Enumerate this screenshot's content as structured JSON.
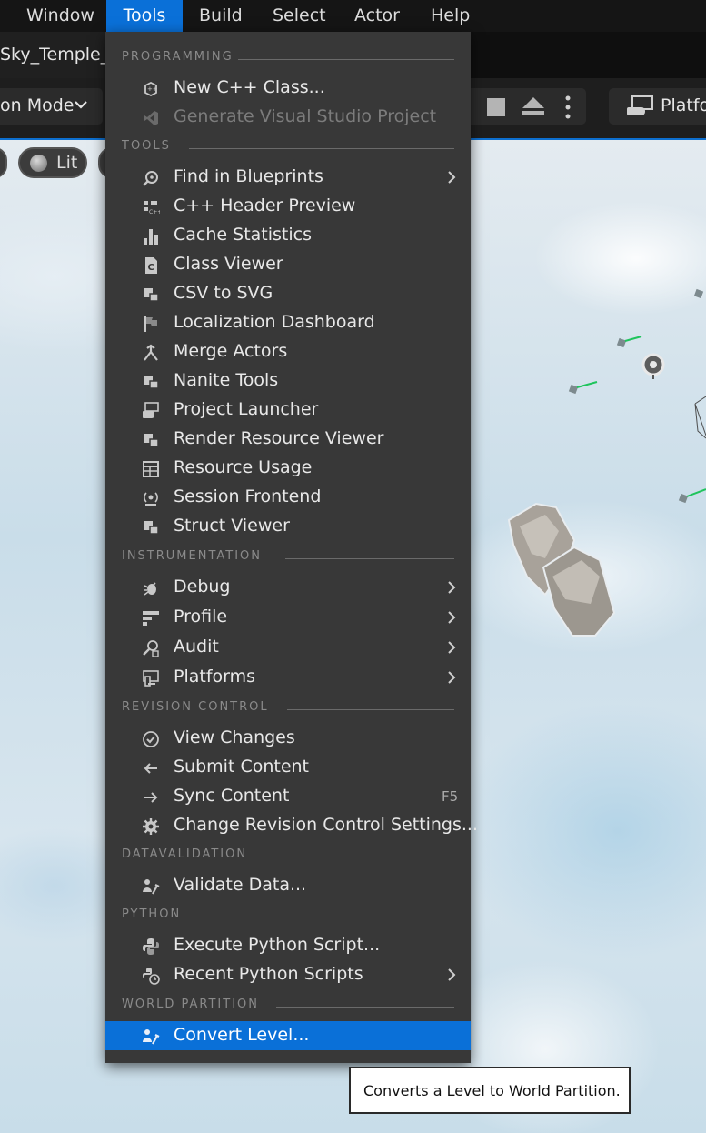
{
  "menubar": {
    "items": [
      {
        "label": "Window"
      },
      {
        "label": "Tools",
        "active": true
      },
      {
        "label": "Build"
      },
      {
        "label": "Select"
      },
      {
        "label": "Actor"
      },
      {
        "label": "Help"
      }
    ]
  },
  "tab": {
    "title": "Sky_Temple_D"
  },
  "toolbar": {
    "mode_label": "on Mode",
    "platforms_label": "Platfo"
  },
  "viewport": {
    "view_mode_label": "Lit"
  },
  "menu": {
    "sections": [
      {
        "label": "PROGRAMMING"
      },
      {
        "label": "TOOLS"
      },
      {
        "label": "INSTRUMENTATION"
      },
      {
        "label": "REVISION CONTROL"
      },
      {
        "label": "DATAVALIDATION"
      },
      {
        "label": "PYTHON"
      },
      {
        "label": "WORLD PARTITION"
      }
    ],
    "items": [
      {
        "label": "New C++ Class...",
        "icon": "cpp-class-icon"
      },
      {
        "label": "Generate Visual Studio Project",
        "icon": "visual-studio-icon",
        "disabled": true
      },
      {
        "label": "Find in Blueprints",
        "icon": "find-in-blueprints-icon",
        "submenu": true
      },
      {
        "label": "C++ Header Preview",
        "icon": "cpp-header-icon"
      },
      {
        "label": "Cache Statistics",
        "icon": "bar-chart-icon"
      },
      {
        "label": "Class Viewer",
        "icon": "class-viewer-icon"
      },
      {
        "label": "CSV to SVG",
        "icon": "tabs-icon"
      },
      {
        "label": "Localization Dashboard",
        "icon": "flag-icon"
      },
      {
        "label": "Merge Actors",
        "icon": "merge-icon"
      },
      {
        "label": "Nanite Tools",
        "icon": "tabs-icon"
      },
      {
        "label": "Project Launcher",
        "icon": "launcher-icon"
      },
      {
        "label": "Render Resource Viewer",
        "icon": "tabs-icon"
      },
      {
        "label": "Resource Usage",
        "icon": "table-icon"
      },
      {
        "label": "Session Frontend",
        "icon": "broadcast-icon"
      },
      {
        "label": "Struct Viewer",
        "icon": "tabs-icon"
      },
      {
        "label": "Debug",
        "icon": "bug-icon",
        "submenu": true
      },
      {
        "label": "Profile",
        "icon": "profile-icon",
        "submenu": true
      },
      {
        "label": "Audit",
        "icon": "audit-icon",
        "submenu": true
      },
      {
        "label": "Platforms",
        "icon": "platforms-icon",
        "submenu": true
      },
      {
        "label": "View Changes",
        "icon": "check-circle-icon"
      },
      {
        "label": "Submit Content",
        "icon": "arrow-left-icon"
      },
      {
        "label": "Sync Content",
        "icon": "arrow-right-icon",
        "shortcut": "F5"
      },
      {
        "label": "Change Revision Control Settings...",
        "icon": "gear-icon"
      },
      {
        "label": "Validate Data...",
        "icon": "validate-icon"
      },
      {
        "label": "Execute Python Script...",
        "icon": "python-icon"
      },
      {
        "label": "Recent Python Scripts",
        "icon": "python-recent-icon",
        "submenu": true
      },
      {
        "label": "Convert Level...",
        "icon": "convert-level-icon",
        "highlighted": true
      }
    ]
  },
  "tooltip": {
    "text": "Converts a Level to World Partition."
  }
}
